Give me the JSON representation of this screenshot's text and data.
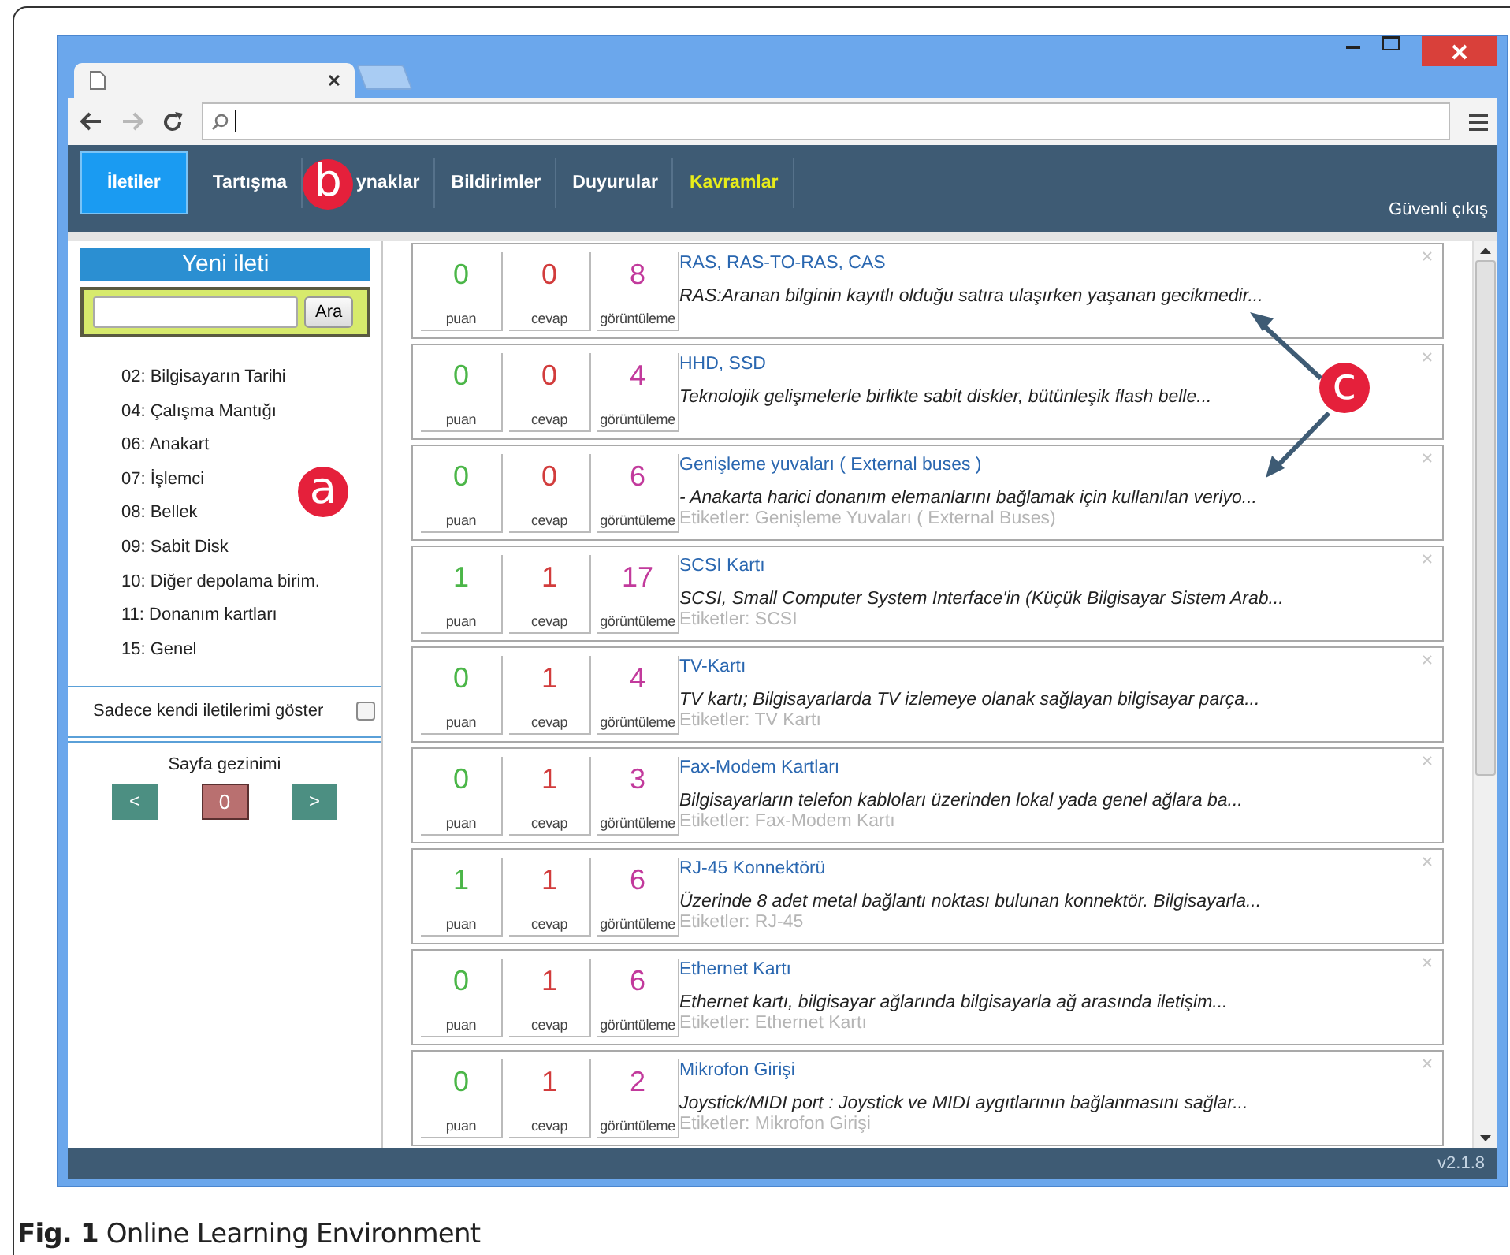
{
  "nav": {
    "tabs": [
      {
        "label": "İletiler",
        "selected": true,
        "kind": "normal"
      },
      {
        "label": "Tartışma",
        "selected": false,
        "kind": "normal"
      },
      {
        "label": "ynaklar",
        "selected": false,
        "kind": "normal"
      },
      {
        "label": "Bildirimler",
        "selected": false,
        "kind": "normal"
      },
      {
        "label": "Duyurular",
        "selected": false,
        "kind": "normal"
      },
      {
        "label": "Kavramlar",
        "selected": false,
        "kind": "highlight"
      }
    ],
    "logout": "Güvenli çıkış"
  },
  "sidebar": {
    "new_post": "Yeni ileti",
    "search_button": "Ara",
    "categories": [
      "02: Bilgisayarın Tarihi",
      "04: Çalışma Mantığı",
      "06: Anakart",
      "07: İşlemci",
      "08: Bellek",
      "09: Sabit Disk",
      "10: Diğer depolama birim.",
      "11: Donanım kartları",
      "15: Genel"
    ],
    "own_only": {
      "label": "Sadece kendi iletilerimi göster",
      "checked": false
    },
    "pagination": {
      "title": "Sayfa gezinimi",
      "prev": "<",
      "page": "0",
      "next": ">"
    }
  },
  "posts": [
    {
      "score": "0",
      "score_label": "puan",
      "answers": "0",
      "answers_label": "cevap",
      "views": "8",
      "views_label": "görüntüleme",
      "title": "RAS, RAS-TO-RAS, CAS",
      "summary": "RAS:Aranan bilginin kayıtlı olduğu satıra ulaşırken yaşanan gecikmedir..."
    },
    {
      "score": "0",
      "score_label": "puan",
      "answers": "0",
      "answers_label": "cevap",
      "views": "4",
      "views_label": "görüntüleme",
      "title": "HHD, SSD",
      "summary": "Teknolojik gelişmelerle birlikte sabit diskler, bütünleşik flash belle..."
    },
    {
      "score": "0",
      "score_label": "puan",
      "answers": "0",
      "answers_label": "cevap",
      "views": "6",
      "views_label": "görüntüleme",
      "title": "Genişleme yuvaları ( External buses )",
      "summary": "- Anakarta harici donanım elemanlarını bağlamak için kullanılan veriyo...",
      "tags": "Etiketler: Genişleme Yuvaları ( External Buses)"
    },
    {
      "score": "1",
      "score_label": "puan",
      "answers": "1",
      "answers_label": "cevap",
      "views": "17",
      "views_label": "görüntüleme",
      "title": "SCSI Kartı",
      "summary": "SCSI, Small Computer System Interface'in (Küçük Bilgisayar Sistem Arab...",
      "tags": "Etiketler: SCSI"
    },
    {
      "score": "0",
      "score_label": "puan",
      "answers": "1",
      "answers_label": "cevap",
      "views": "4",
      "views_label": "görüntüleme",
      "title": "TV-Kartı",
      "summary": "TV kartı; Bilgisayarlarda TV izlemeye olanak sağlayan bilgisayar parça...",
      "tags": "Etiketler: TV Kartı"
    },
    {
      "score": "0",
      "score_label": "puan",
      "answers": "1",
      "answers_label": "cevap",
      "views": "3",
      "views_label": "görüntüleme",
      "title": "Fax-Modem Kartları",
      "summary": "Bilgisayarların telefon kabloları üzerinden lokal yada genel ağlara ba...",
      "tags": "Etiketler: Fax-Modem Kartı"
    },
    {
      "score": "1",
      "score_label": "puan",
      "answers": "1",
      "answers_label": "cevap",
      "views": "6",
      "views_label": "görüntüleme",
      "title": "RJ-45 Konnektörü",
      "summary": "Üzerinde 8 adet metal bağlantı noktası bulunan konnektör. Bilgisayarla...",
      "tags": "Etiketler: RJ-45"
    },
    {
      "score": "0",
      "score_label": "puan",
      "answers": "1",
      "answers_label": "cevap",
      "views": "6",
      "views_label": "görüntüleme",
      "title": "Ethernet Kartı",
      "summary": "Ethernet kartı, bilgisayar ağlarında bilgisayarla ağ arasında iletişim...",
      "tags": "Etiketler: Ethernet Kartı"
    },
    {
      "score": "0",
      "score_label": "puan",
      "answers": "1",
      "answers_label": "cevap",
      "views": "2",
      "views_label": "görüntüleme",
      "title": "Mikrofon Girişi",
      "summary": "Joystick/MIDI port : Joystick ve MIDI aygıtlarının bağlanmasını sağlar...",
      "tags": "Etiketler: Mikrofon Girişi"
    }
  ],
  "footer": {
    "version": "v2.1.8"
  },
  "annotations": [
    {
      "label": "a"
    },
    {
      "label": "b"
    },
    {
      "label": "c"
    }
  ],
  "caption": "**Fig. 1** Online Learning Environment"
}
